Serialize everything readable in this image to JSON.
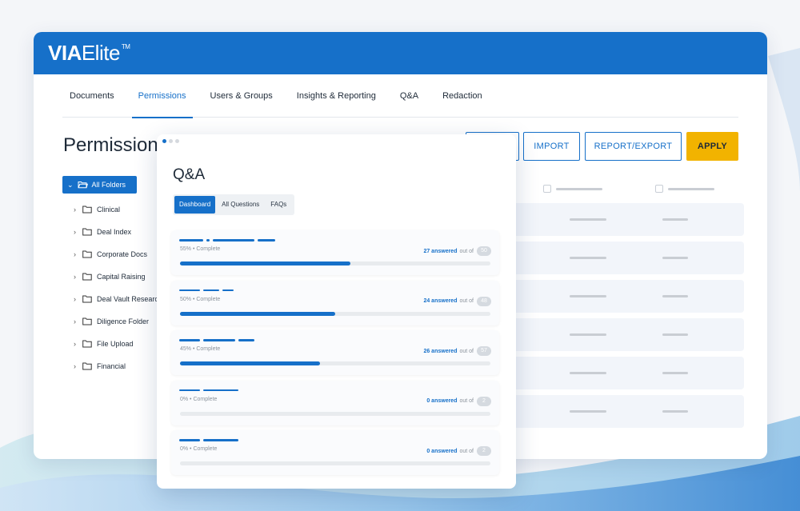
{
  "app": {
    "logo_bold": "VIA",
    "logo_light": "Elite",
    "logo_tm": "TM"
  },
  "nav": {
    "tabs": [
      {
        "label": "Documents",
        "active": false
      },
      {
        "label": "Permissions",
        "active": true
      },
      {
        "label": "Users & Groups",
        "active": false
      },
      {
        "label": "Insights & Reporting",
        "active": false
      },
      {
        "label": "Q&A",
        "active": false
      },
      {
        "label": "Redaction",
        "active": false
      }
    ]
  },
  "page": {
    "title": "Permissions"
  },
  "toolbar": {
    "import_label": "IMPORT",
    "report_export_label": "REPORT/EXPORT",
    "apply_label": "APPLY"
  },
  "folders": {
    "root_label": "All Folders",
    "items": [
      "Clinical",
      "Deal Index",
      "Corporate Docs",
      "Capital Raising",
      "Deal Vault Research",
      "Diligence Folder",
      "File Upload",
      "Financial"
    ]
  },
  "qa": {
    "title": "Q&A",
    "tabs": [
      {
        "label": "Dashboard",
        "active": true
      },
      {
        "label": "All Questions",
        "active": false
      },
      {
        "label": "FAQs",
        "active": false
      }
    ],
    "cards": [
      {
        "percent_text": "55% • Complete",
        "progress": 0.55,
        "answered_text": "27 answered",
        "out_of_text": "out of",
        "total": "50"
      },
      {
        "percent_text": "50% • Complete",
        "progress": 0.5,
        "answered_text": "24 answered",
        "out_of_text": "out of",
        "total": "48"
      },
      {
        "percent_text": "45% • Complete",
        "progress": 0.45,
        "answered_text": "26 answered",
        "out_of_text": "out of",
        "total": "57"
      },
      {
        "percent_text": "0% • Complete",
        "progress": 0.0,
        "answered_text": "0 answered",
        "out_of_text": "out of",
        "total": "2"
      },
      {
        "percent_text": "0% • Complete",
        "progress": 0.0,
        "answered_text": "0 answered",
        "out_of_text": "out of",
        "total": "2"
      }
    ]
  },
  "colors": {
    "brand_blue": "#1670c9",
    "apply_yellow": "#f2b300",
    "text_dark": "#1e2a38"
  }
}
